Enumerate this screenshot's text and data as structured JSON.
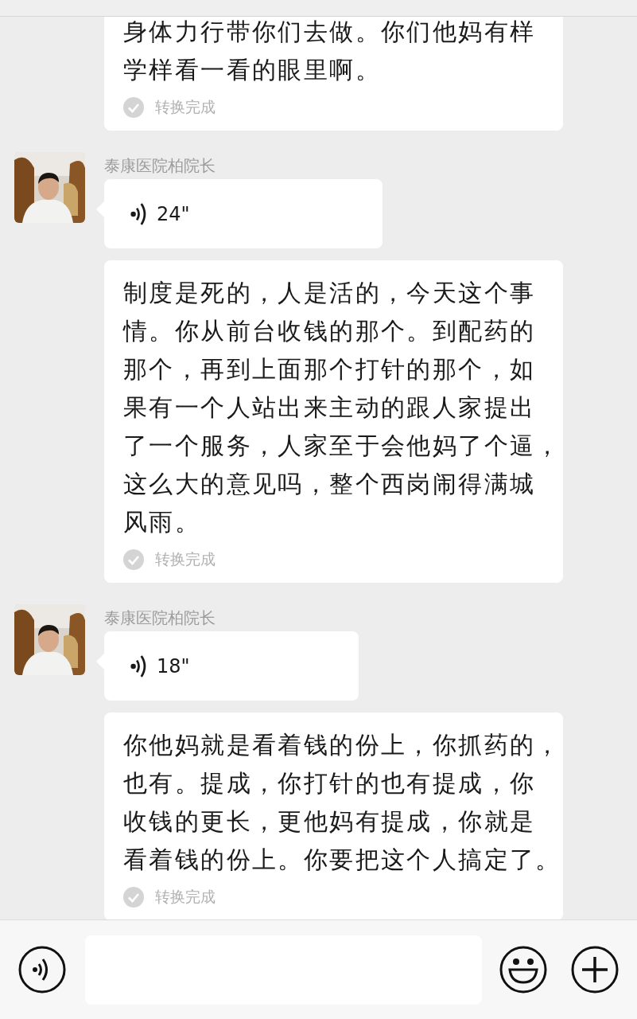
{
  "messages": [
    {
      "kind": "transcript",
      "text": "身体力行带你们去做。你们他妈有样学样看一看的眼里啊。",
      "status": "转换完成"
    },
    {
      "kind": "voice",
      "sender": "泰康医院柏院长",
      "duration": "24\""
    },
    {
      "kind": "transcript",
      "text": "制度是死的，人是活的，今天这个事情。你从前台收钱的那个。到配药的那个，再到上面那个打针的那个，如果有一个人站出来主动的跟人家提出了一个服务，人家至于会他妈了个逼，这么大的意见吗，整个西岗闹得满城风雨。",
      "status": "转换完成"
    },
    {
      "kind": "voice",
      "sender": "泰康医院柏院长",
      "duration": "18\""
    },
    {
      "kind": "transcript",
      "text": "你他妈就是看着钱的份上，你抓药的，也有。提成，你打针的也有提成，你收钱的更长，更他妈有提成，你就是看着钱的份上。你要把这个人搞定了。",
      "status": "转换完成"
    }
  ]
}
